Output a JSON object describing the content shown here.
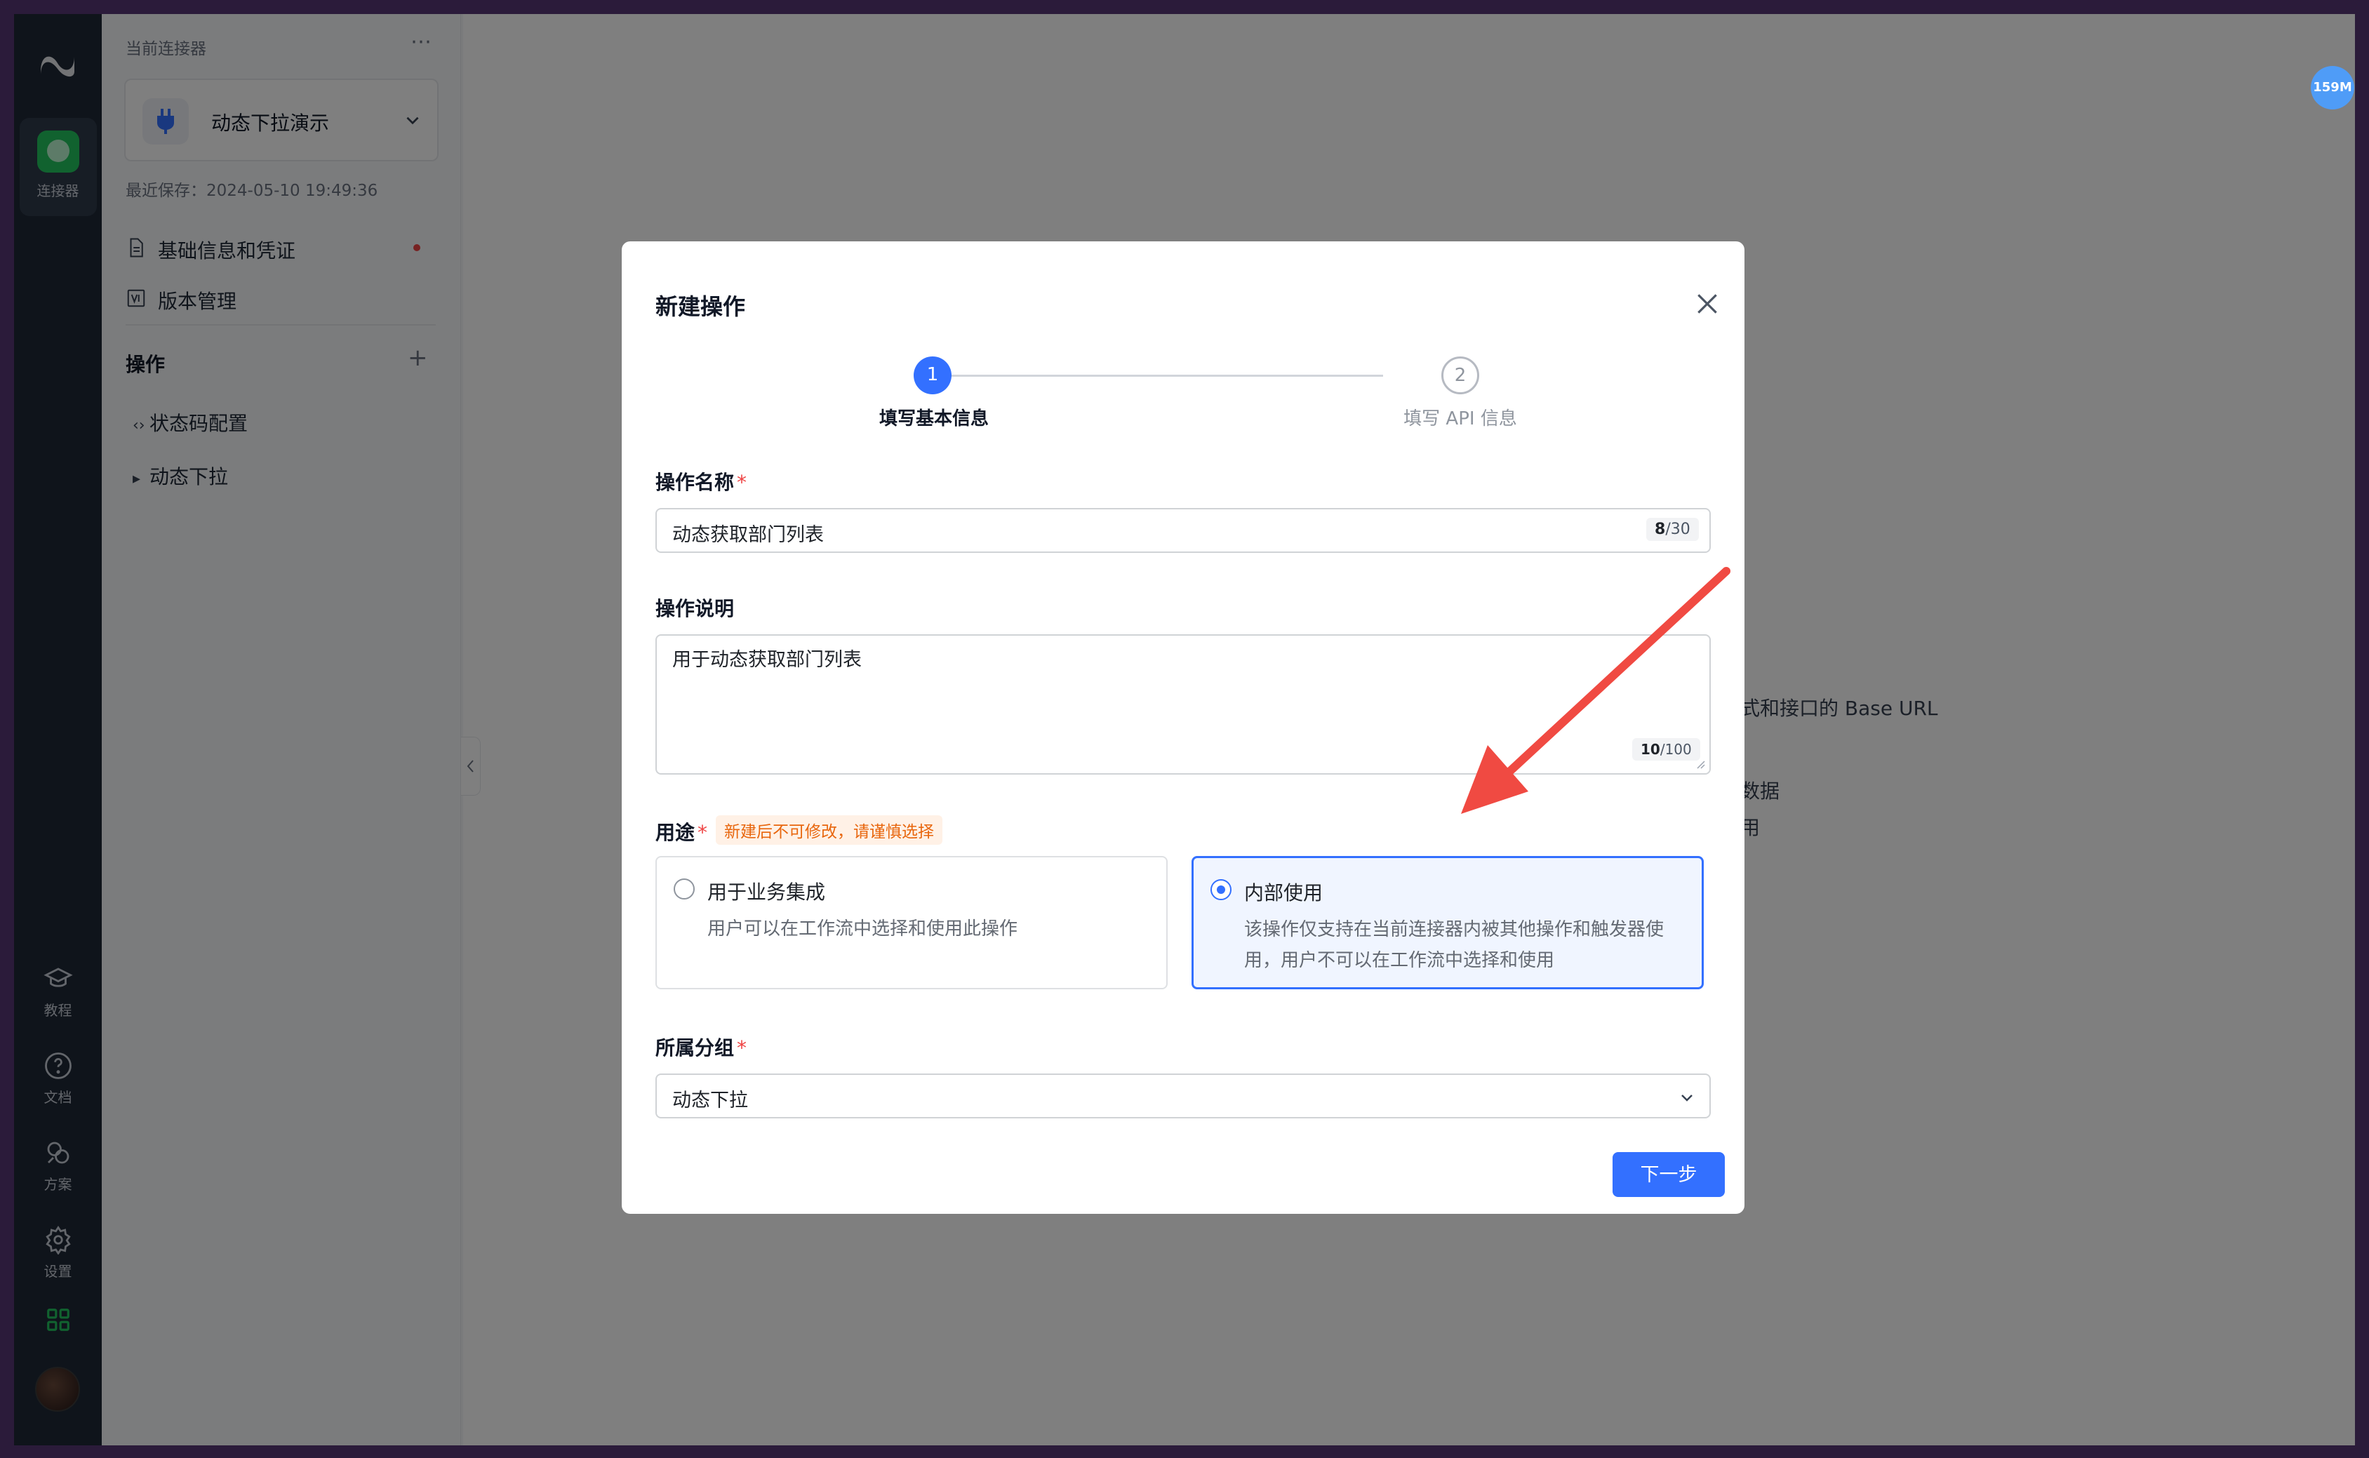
{
  "rail": {
    "active_label": "连接器",
    "items": [
      {
        "label": "教程",
        "icon": "graduation-cap-icon"
      },
      {
        "label": "文档",
        "icon": "help-circle-icon"
      },
      {
        "label": "方案",
        "icon": "solutions-icon"
      },
      {
        "label": "设置",
        "icon": "gear-icon"
      }
    ]
  },
  "sidebar": {
    "section_title": "当前连接器",
    "connector_name": "动态下拉演示",
    "last_saved": "最近保存：2024-05-10 19:49:36",
    "nav": [
      {
        "label": "基础信息和凭证"
      },
      {
        "label": "版本管理"
      }
    ],
    "ops_title": "操作",
    "ops": [
      {
        "label": "状态码配置"
      },
      {
        "label": "动态下拉"
      }
    ]
  },
  "main": {
    "bg_text_1": "式和接口的 Base URL",
    "bg_text_2": "数据",
    "bg_text_3": "用",
    "memory_badge": "159M"
  },
  "modal": {
    "title": "新建操作",
    "steps": [
      {
        "num": "1",
        "label": "填写基本信息"
      },
      {
        "num": "2",
        "label": "填写 API 信息"
      }
    ],
    "name_label": "操作名称",
    "name_value": "动态获取部门列表",
    "name_count": "8",
    "name_max": "/30",
    "desc_label": "操作说明",
    "desc_value": "用于动态获取部门列表",
    "desc_count": "10",
    "desc_max": "/100",
    "usage_label": "用途",
    "usage_warning": "新建后不可修改，请谨慎选择",
    "usage_options": [
      {
        "title": "用于业务集成",
        "desc": "用户可以在工作流中选择和使用此操作",
        "selected": false
      },
      {
        "title": "内部使用",
        "desc": "该操作仅支持在当前连接器内被其他操作和触发器使用，用户不可以在工作流中选择和使用",
        "selected": true
      }
    ],
    "group_label": "所属分组",
    "group_value": "动态下拉",
    "next_button": "下一步",
    "required_mark": "*"
  },
  "colors": {
    "primary": "#3370ff",
    "rail_bg": "#1f2937",
    "warning": "#e8660d",
    "arrow": "#f04a42"
  }
}
